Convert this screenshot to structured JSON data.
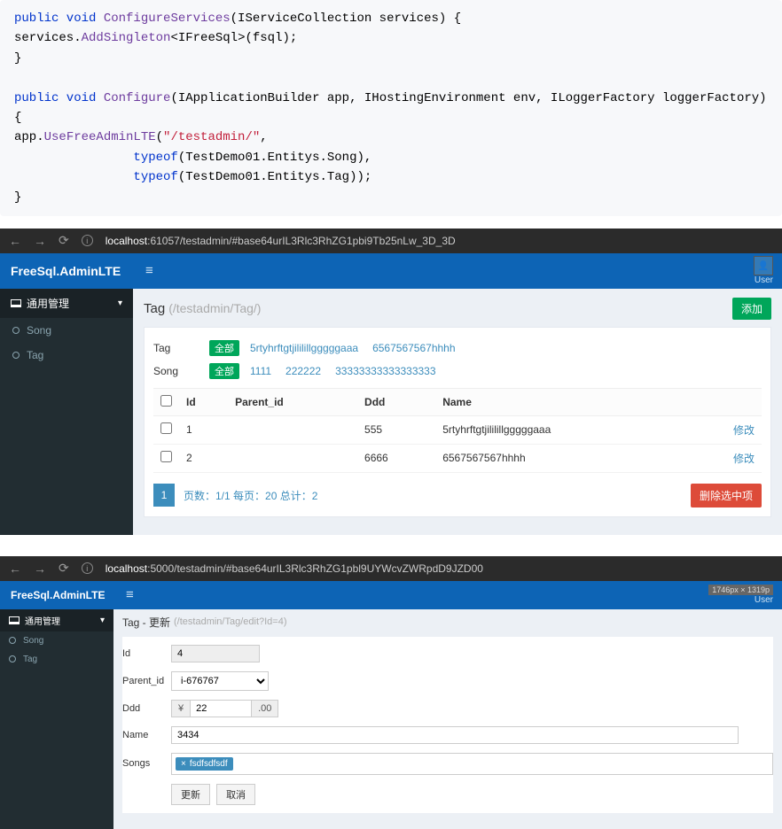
{
  "code": {
    "line1_pre": "public void ",
    "line1_fn": "ConfigureServices",
    "line1_post": "(IServiceCollection services) {",
    "line2_pre": "        services.",
    "line2_m": "AddSingleton",
    "line2_post1": "<IFreeSql>(fsql);",
    "line3": "}",
    "line4_pre": "public void ",
    "line4_fn": "Configure",
    "line4_post": "(IApplicationBuilder app, IHostingEnvironment env, ILoggerFactory loggerFactory) {",
    "line5_pre": "        app.",
    "line5_m": "UseFreeAdminLTE",
    "line5_str": "\"/testadmin/\"",
    "line5_post": ",",
    "line6_kw": "typeof",
    "line6_arg": "(TestDemo01.Entitys.Song),",
    "line7_kw": "typeof",
    "line7_arg": "(TestDemo01.Entitys.Tag));",
    "line8": "}"
  },
  "app1": {
    "url_host": "localhost",
    "url_rest": ":61057/testadmin/#base64urIL3Rlc3RhZG1pbi9Tb25nLw_3D_3D",
    "brand": "FreeSql.AdminLTE",
    "user_label": "User",
    "sidebar": {
      "group": "通用管理",
      "items": [
        "Song",
        "Tag"
      ]
    },
    "breadcrumb": {
      "title": "Tag",
      "path": "(/testadmin/Tag/)"
    },
    "add_btn": "添加",
    "filters": {
      "tag_label": "Tag",
      "tag_all": "全部",
      "tag_items": [
        "5rtyhrftgtjililillgggggaaa",
        "6567567567hhhh"
      ],
      "song_label": "Song",
      "song_all": "全部",
      "song_items": [
        "1111",
        "222222",
        "33333333333333333"
      ]
    },
    "table": {
      "headers": [
        "Id",
        "Parent_id",
        "Ddd",
        "Name",
        ""
      ],
      "rows": [
        {
          "id": "1",
          "parent": "",
          "ddd": "555",
          "name": "5rtyhrftgtjililillgggggaaa",
          "act": "修改"
        },
        {
          "id": "2",
          "parent": "",
          "ddd": "6666",
          "name": "6567567567hhhh",
          "act": "修改"
        }
      ]
    },
    "pager": {
      "page": "1",
      "info": "页数：1/1 每页：20 总计：2"
    },
    "delete_btn": "删除选中项"
  },
  "app2": {
    "url_host": "localhost",
    "url_rest": ":5000/testadmin/#base64urIL3Rlc3RhZG1pbl9UYWcvZWRpdD9JZD00",
    "brand": "FreeSql.AdminLTE",
    "dim_badge": "1746px × 1319p",
    "user_label": "User",
    "sidebar": {
      "group": "通用管理",
      "items": [
        "Song",
        "Tag"
      ]
    },
    "breadcrumb": {
      "title": "Tag - 更新",
      "path": "(/testadmin/Tag/edit?Id=4)"
    },
    "form": {
      "id_label": "Id",
      "id_value": "4",
      "parent_label": "Parent_id",
      "parent_value": "i-676767",
      "ddd_label": "Ddd",
      "ddd_pre": "¥",
      "ddd_value": "22",
      "ddd_suf": ".00",
      "name_label": "Name",
      "name_value": "3434",
      "songs_label": "Songs",
      "songs_chip": "fsdfsdfsdf",
      "chip_x": "×",
      "btn_update": "更新",
      "btn_cancel": "取消"
    }
  }
}
